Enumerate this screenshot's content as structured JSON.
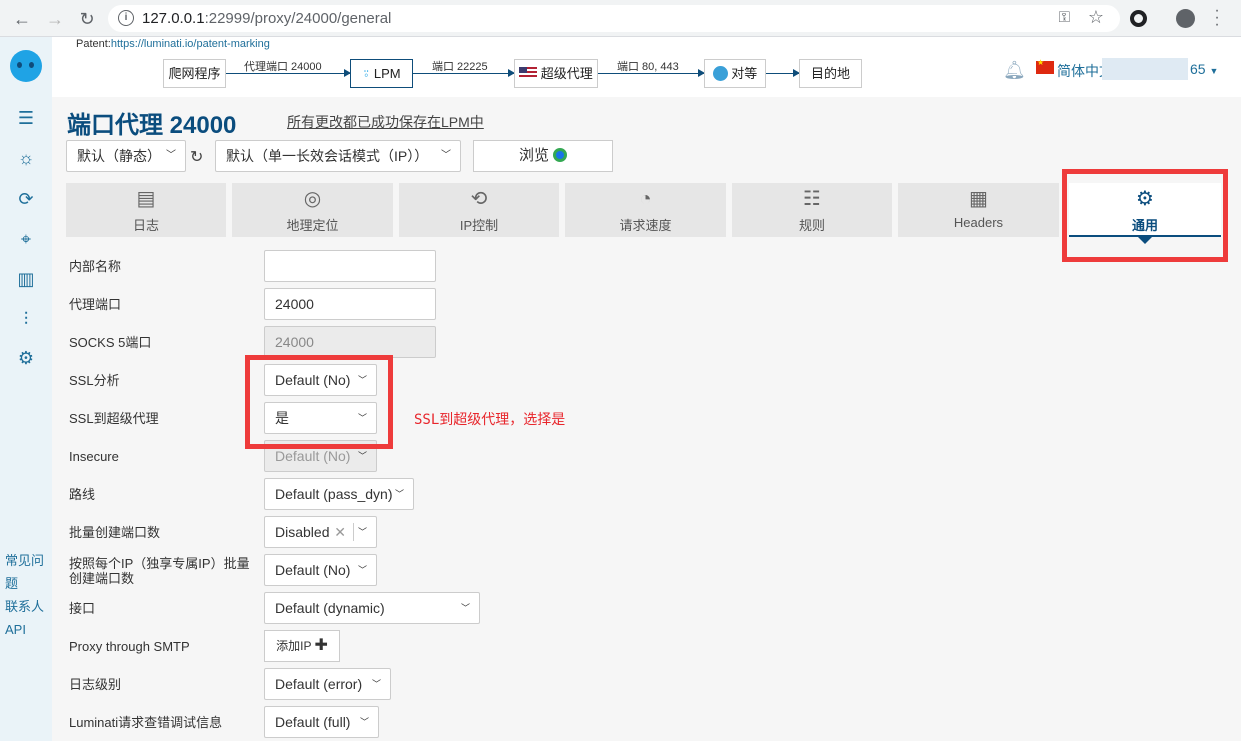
{
  "browser": {
    "url_host": "127.0.0.1",
    "url_rest": ":22999/proxy/24000/general"
  },
  "header": {
    "patent_label": "Patent:",
    "patent_link": "https://luminati.io/patent-marking",
    "flow": {
      "crawler": "爬网程序",
      "proxy_port_label": "代理端口 24000",
      "lpm": "LPM",
      "port_22225_label": "端口 22225",
      "super_proxy": "超级代理",
      "port_80_443_label": "端口 80, 443",
      "peer": "对等",
      "destination": "目的地"
    },
    "language_prefix": "简体中文",
    "language_suffix": "65"
  },
  "sidebar": {
    "links": [
      "常见问题",
      "联系人",
      "API"
    ]
  },
  "page": {
    "title": "端口代理 24000",
    "saved_note": "所有更改都已成功保存在LPM中",
    "preset_select": "默认（静态）",
    "session_select": "默认（单一长效会话模式（IP））",
    "browse_button": "浏览"
  },
  "tabs": [
    {
      "label": "日志",
      "icon": "logs-icon"
    },
    {
      "label": "地理定位",
      "icon": "fingerprint-icon"
    },
    {
      "label": "IP控制",
      "icon": "refresh-icon"
    },
    {
      "label": "请求速度",
      "icon": "speedometer-icon"
    },
    {
      "label": "规则",
      "icon": "rules-icon"
    },
    {
      "label": "Headers",
      "icon": "headers-icon"
    },
    {
      "label": "通用",
      "icon": "gear-icon",
      "active": true
    }
  ],
  "form": {
    "internal_name": {
      "label": "内部名称",
      "value": ""
    },
    "proxy_port": {
      "label": "代理端口",
      "value": "24000"
    },
    "socks_port": {
      "label": "SOCKS 5端口",
      "value": "24000"
    },
    "ssl_analysis": {
      "label": "SSL分析",
      "value": "Default (No)"
    },
    "ssl_to_super": {
      "label": "SSL到超级代理",
      "value": "是"
    },
    "insecure": {
      "label": "Insecure",
      "value": "Default (No)"
    },
    "route": {
      "label": "路线",
      "value": "Default (pass_dyn)"
    },
    "bulk_ports": {
      "label": "批量创建端口数",
      "value": "Disabled"
    },
    "per_ip_ports": {
      "label": "按照每个IP（独享专属IP）批量创建端口数",
      "value": "Default (No)"
    },
    "interface": {
      "label": "接口",
      "value": "Default (dynamic)"
    },
    "smtp": {
      "label": "Proxy through SMTP",
      "button": "添加IP"
    },
    "log_level": {
      "label": "日志级别",
      "value": "Default (error)"
    },
    "debug_info": {
      "label": "Luminati请求查错调试信息",
      "value": "Default (full)"
    }
  },
  "annotation": "SSL到超级代理，选择是",
  "colors": {
    "brand": "#0b4d7e",
    "annotation_red": "#ee3b3b"
  }
}
